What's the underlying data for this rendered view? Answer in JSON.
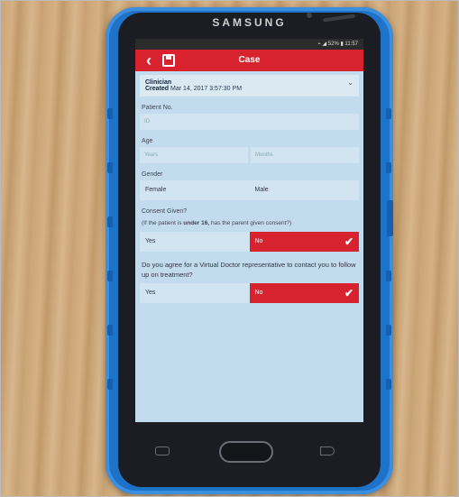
{
  "device": {
    "brand": "SAMSUNG"
  },
  "statusbar": {
    "text": "⌁ ◢ 52% ▮ 11:57"
  },
  "appbar": {
    "title": "Case"
  },
  "case_info": {
    "role": "Clinician",
    "created_label": "Created",
    "created_value": "Mar 14, 2017 3:57:30 PM"
  },
  "patient_no": {
    "label": "Patient No.",
    "placeholder": "ID"
  },
  "age": {
    "label": "Age",
    "years_placeholder": "Years",
    "months_placeholder": "Months"
  },
  "gender": {
    "label": "Gender",
    "options": [
      "Female",
      "Male"
    ]
  },
  "consent": {
    "label": "Consent Given?",
    "note_prefix": "(If the patient is ",
    "note_bold": "under 16,",
    "note_suffix": " has the parent given consent?)",
    "yes_label": "Yes",
    "no_label": "No",
    "selected": "No"
  },
  "followup": {
    "question": "Do you agree for a Virtual Doctor representative to contact you to follow up on treatment?",
    "yes_label": "Yes",
    "no_label": "No",
    "selected": "No"
  }
}
